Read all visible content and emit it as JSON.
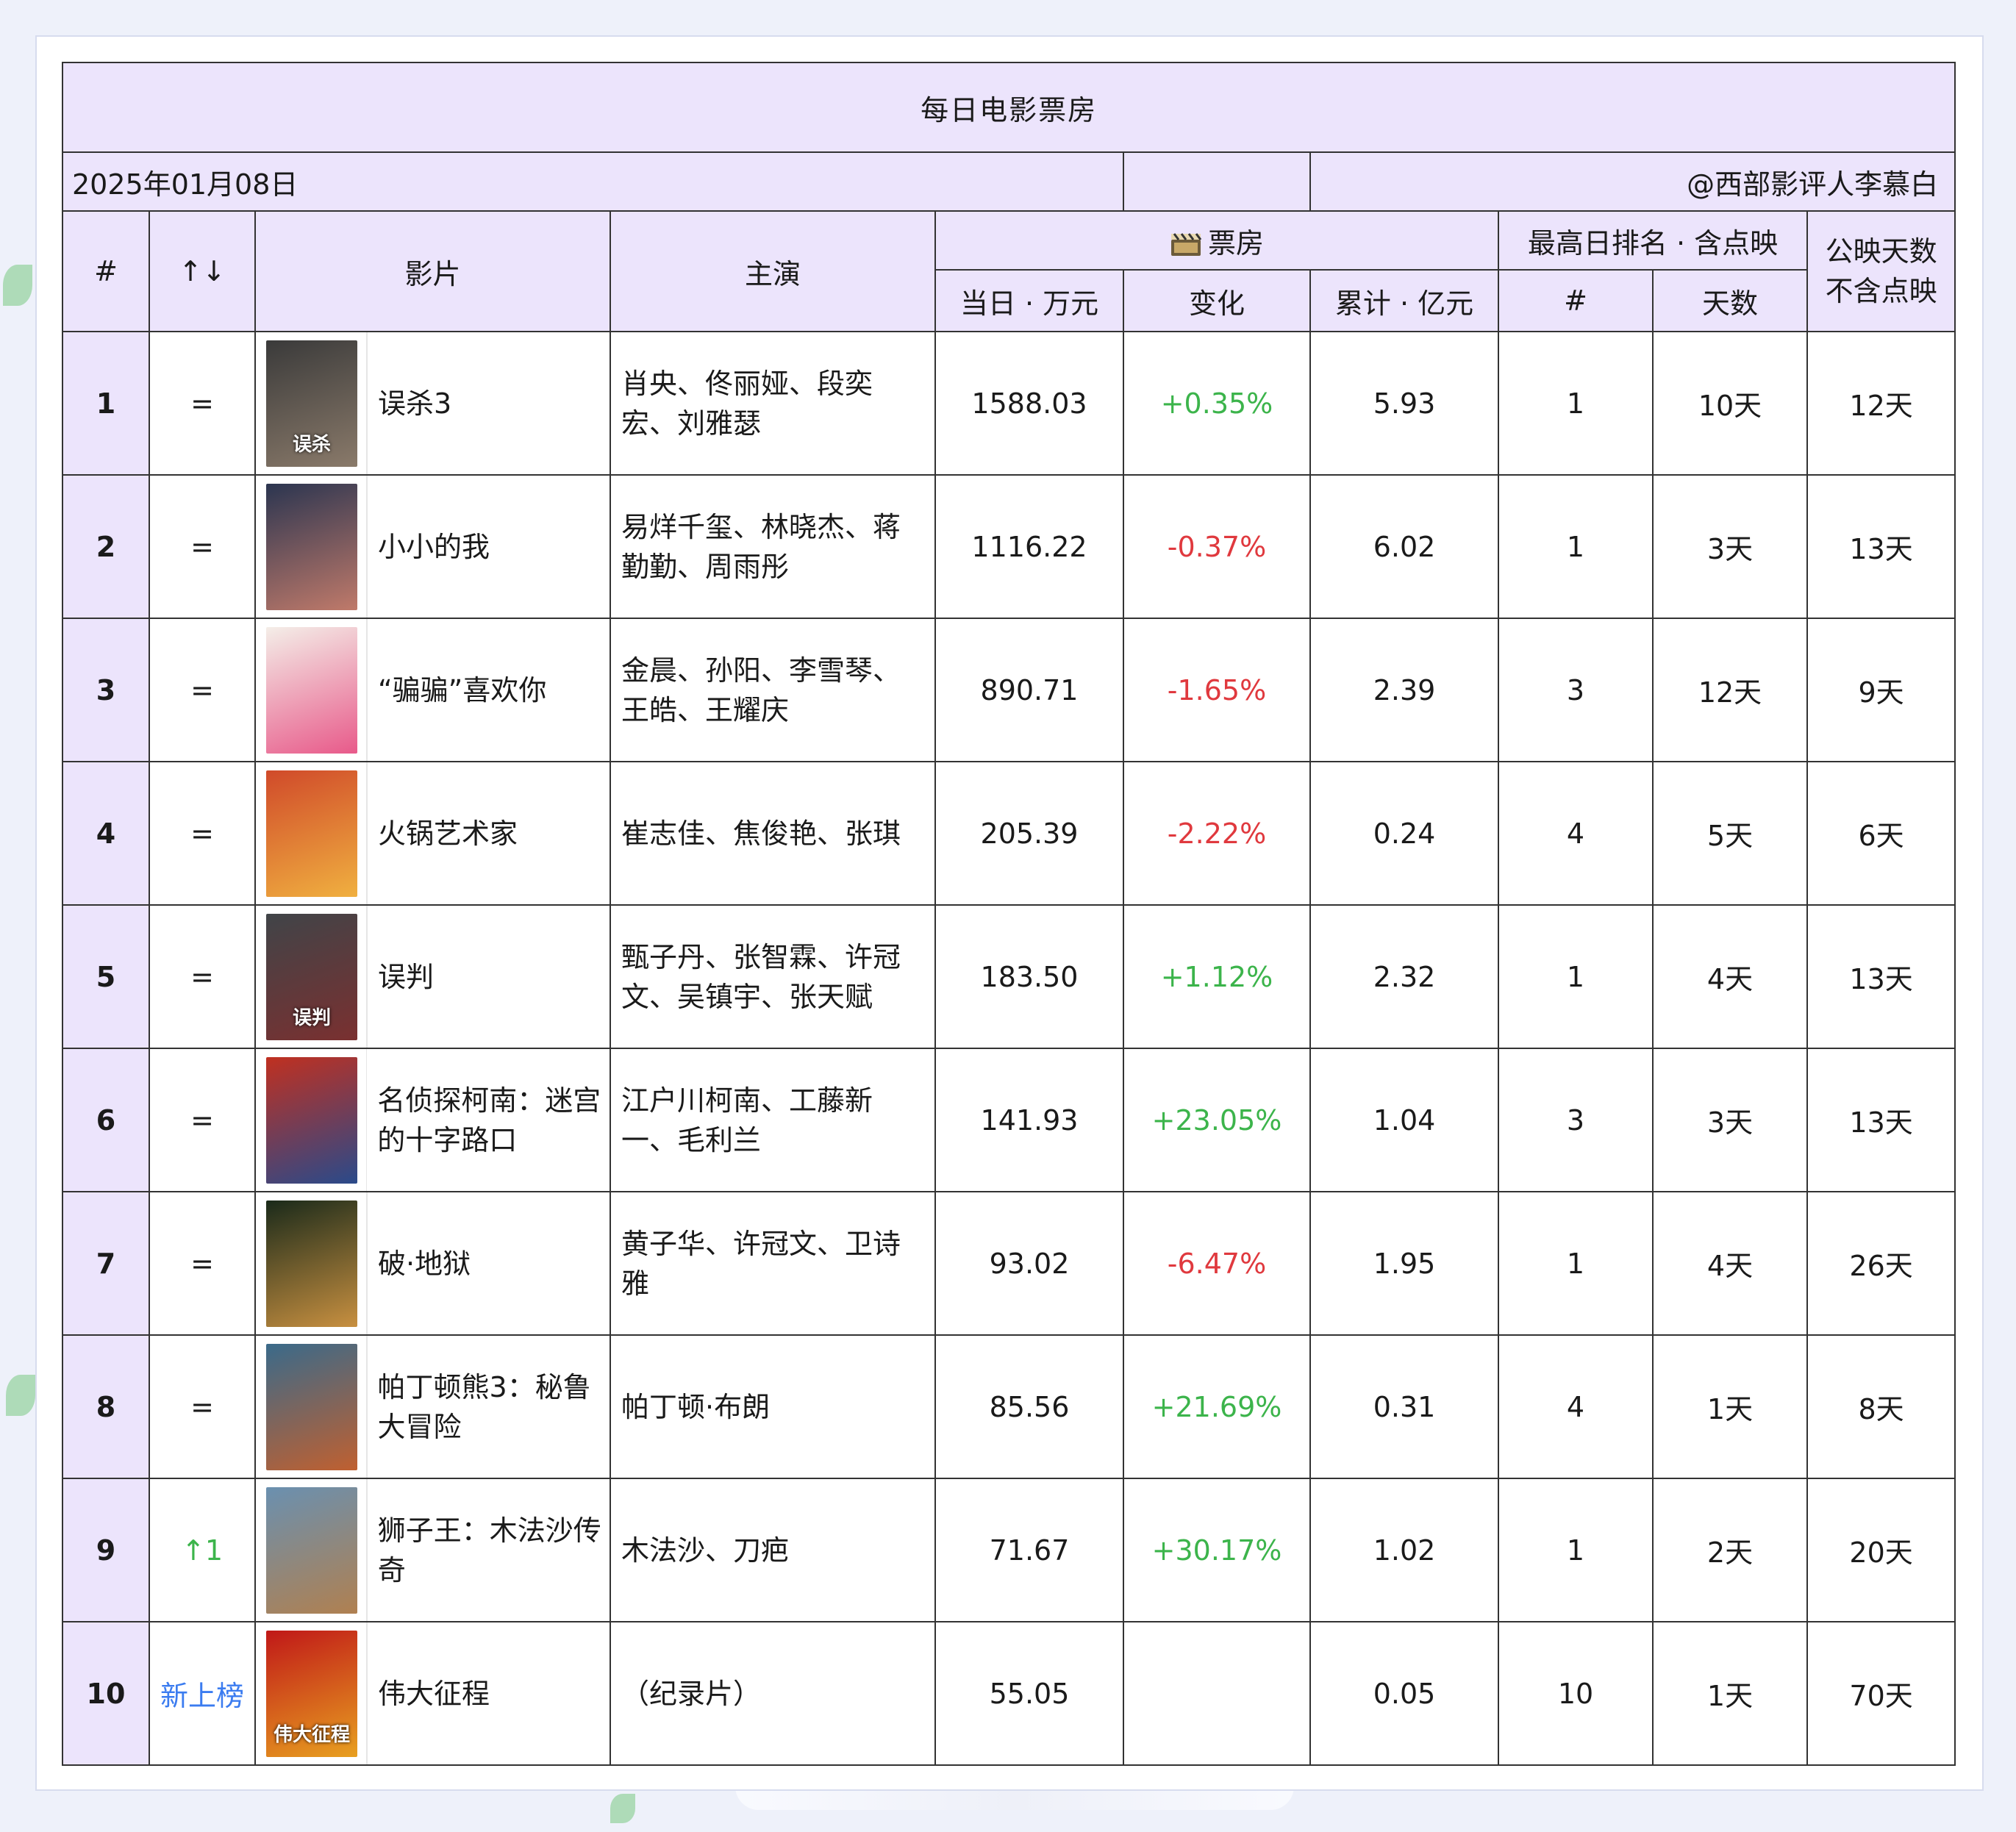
{
  "table_title": "每日电影票房",
  "date": "2025年01月08日",
  "credit": "@西部影评人李慕白",
  "headers": {
    "rank": "#",
    "change": "↑↓",
    "film": "影片",
    "cast": "主演",
    "box_office_group": "票房",
    "box_office_icon": "film-clapper-icon",
    "daily": "当日 · 万元",
    "delta": "变化",
    "cumulative": "累计 · 亿元",
    "best_rank_group": "最高日排名 · 含点映",
    "best_rank": "#",
    "best_days": "天数",
    "release_days_line1": "公映天数",
    "release_days_line2": "不含点映"
  },
  "colors": {
    "header_bg": "#ece4fc",
    "positive": "#3cb44b",
    "negative": "#e0393e",
    "new_entry": "#3b7cf0"
  },
  "rows": [
    {
      "rank": "1",
      "move": "=",
      "move_type": "same",
      "film": "误杀3",
      "poster_colors": [
        "#3a3a3a",
        "#8a7a6a"
      ],
      "poster_text": "误杀",
      "cast": "肖央、佟丽娅、段奕宏、刘雅瑟",
      "daily": "1588.03",
      "delta": "+0.35%",
      "delta_type": "pos",
      "cumulative": "5.93",
      "best_rank": "1",
      "best_days": "10天",
      "release_days": "12天"
    },
    {
      "rank": "2",
      "move": "=",
      "move_type": "same",
      "film": "小小的我",
      "poster_colors": [
        "#2b3550",
        "#c07a6a"
      ],
      "poster_text": "",
      "cast": "易烊千玺、林晓杰、蒋勤勤、周雨彤",
      "daily": "1116.22",
      "delta": "-0.37%",
      "delta_type": "neg",
      "cumulative": "6.02",
      "best_rank": "1",
      "best_days": "3天",
      "release_days": "13天"
    },
    {
      "rank": "3",
      "move": "=",
      "move_type": "same",
      "film": "“骗骗”喜欢你",
      "poster_colors": [
        "#f4eee8",
        "#e85a8a"
      ],
      "poster_text": "",
      "cast": "金晨、孙阳、李雪琴、王皓、王耀庆",
      "daily": "890.71",
      "delta": "-1.65%",
      "delta_type": "neg",
      "cumulative": "2.39",
      "best_rank": "3",
      "best_days": "12天",
      "release_days": "9天"
    },
    {
      "rank": "4",
      "move": "=",
      "move_type": "same",
      "film": "火锅艺术家",
      "poster_colors": [
        "#d04a2a",
        "#f0b040"
      ],
      "poster_text": "",
      "cast": "崔志佳、焦俊艳、张琪",
      "daily": "205.39",
      "delta": "-2.22%",
      "delta_type": "neg",
      "cumulative": "0.24",
      "best_rank": "4",
      "best_days": "5天",
      "release_days": "6天"
    },
    {
      "rank": "5",
      "move": "=",
      "move_type": "same",
      "film": "误判",
      "poster_colors": [
        "#404448",
        "#7a3030"
      ],
      "poster_text": "误判",
      "cast": "甄子丹、张智霖、许冠文、吴镇宇、张天赋",
      "daily": "183.50",
      "delta": "+1.12%",
      "delta_type": "pos",
      "cumulative": "2.32",
      "best_rank": "1",
      "best_days": "4天",
      "release_days": "13天"
    },
    {
      "rank": "6",
      "move": "=",
      "move_type": "same",
      "film": "名侦探柯南：迷宫的十字路口",
      "poster_colors": [
        "#c03020",
        "#2a4a8a"
      ],
      "poster_text": "",
      "cast": "江户川柯南、工藤新一、毛利兰",
      "daily": "141.93",
      "delta": "+23.05%",
      "delta_type": "pos",
      "cumulative": "1.04",
      "best_rank": "3",
      "best_days": "3天",
      "release_days": "13天"
    },
    {
      "rank": "7",
      "move": "=",
      "move_type": "same",
      "film": "破·地狱",
      "poster_colors": [
        "#1a2a1a",
        "#c89040"
      ],
      "poster_text": "",
      "cast": "黄子华、许冠文、卫诗雅",
      "daily": "93.02",
      "delta": "-6.47%",
      "delta_type": "neg",
      "cumulative": "1.95",
      "best_rank": "1",
      "best_days": "4天",
      "release_days": "26天"
    },
    {
      "rank": "8",
      "move": "=",
      "move_type": "same",
      "film": "帕丁顿熊3：秘鲁大冒险",
      "poster_colors": [
        "#3a6a8a",
        "#c06030"
      ],
      "poster_text": "",
      "cast": "帕丁顿·布朗",
      "daily": "85.56",
      "delta": "+21.69%",
      "delta_type": "pos",
      "cumulative": "0.31",
      "best_rank": "4",
      "best_days": "1天",
      "release_days": "8天"
    },
    {
      "rank": "9",
      "move": "↑1",
      "move_type": "up",
      "film": "狮子王：木法沙传奇",
      "poster_colors": [
        "#6a90b0",
        "#b08050"
      ],
      "poster_text": "",
      "cast": "木法沙、刀疤",
      "daily": "71.67",
      "delta": "+30.17%",
      "delta_type": "pos",
      "cumulative": "1.02",
      "best_rank": "1",
      "best_days": "2天",
      "release_days": "20天"
    },
    {
      "rank": "10",
      "move": "新上榜",
      "move_type": "new",
      "film": "伟大征程",
      "poster_colors": [
        "#c01818",
        "#e8a020"
      ],
      "poster_text": "伟大征程",
      "cast": "（纪录片）",
      "daily": "55.05",
      "delta": "",
      "delta_type": "none",
      "cumulative": "0.05",
      "best_rank": "10",
      "best_days": "1天",
      "release_days": "70天"
    }
  ]
}
